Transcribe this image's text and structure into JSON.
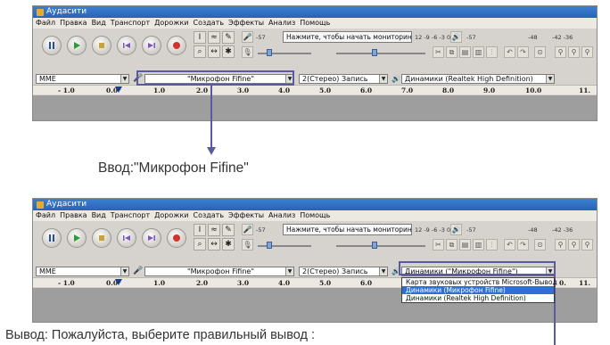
{
  "app": {
    "title": "Аудасити",
    "menu": [
      "Файл",
      "Правка",
      "Вид",
      "Транспорт",
      "Дорожки",
      "Создать",
      "Эффекты",
      "Анализ",
      "Помощь"
    ]
  },
  "toolbar": {
    "monitor_prompt": "Нажмите, чтобы начать мониторинг",
    "record_meter_scale": "12 -9 -6 -3 0",
    "record_meter_label": "R",
    "play_meter_scale_left": "-57",
    "play_meter_scale_mid": "-48",
    "play_meter_scale_right": "-42  -36",
    "play_meter_label": "R",
    "rec_slider_label": "-57",
    "icons": [
      "pause-icon",
      "play-icon",
      "stop-icon",
      "skip-start-icon",
      "skip-end-icon",
      "record-icon"
    ]
  },
  "device_bar_top": {
    "host": "MME",
    "input_device": "\"Микрофон Fifine\"",
    "channels": "2(Стерео) Запись",
    "output_device": "Динамики (Realtek High Definition)"
  },
  "device_bar_bottom": {
    "host": "MME",
    "input_device": "\"Микрофон Fifine\"",
    "channels": "2(Стерео) Запись",
    "output_device": "Динамики (\"Микрофон Fifine\")",
    "dropdown_options": [
      "Карта звуковых устройств Microsoft-Вывод",
      "Динамики (Микрофон Fifine)",
      "Динамики (Realtek High Definition)"
    ],
    "dropdown_selected_index": 1
  },
  "ruler": [
    "- 1.0",
    "0.0",
    "1.0",
    "2.0",
    "3.0",
    "4.0",
    "5.0",
    "6.0",
    "7.0",
    "8.0",
    "9.0",
    "10.0",
    "11."
  ],
  "ruler_bottom": [
    "- 1.0",
    "0.0",
    "1.0",
    "2.0",
    "3.0",
    "4.0",
    "5.0",
    "6.0",
    "0.",
    "11."
  ],
  "captions": {
    "input": "Ввод:\"Микрофон Fifine\"",
    "output": "Вывод: Пожалуйста, выберите правильный вывод :"
  },
  "colors": {
    "callout": "#5a5aa0",
    "titlebar": "#2a63b8",
    "selection": "#2f6fd6"
  }
}
